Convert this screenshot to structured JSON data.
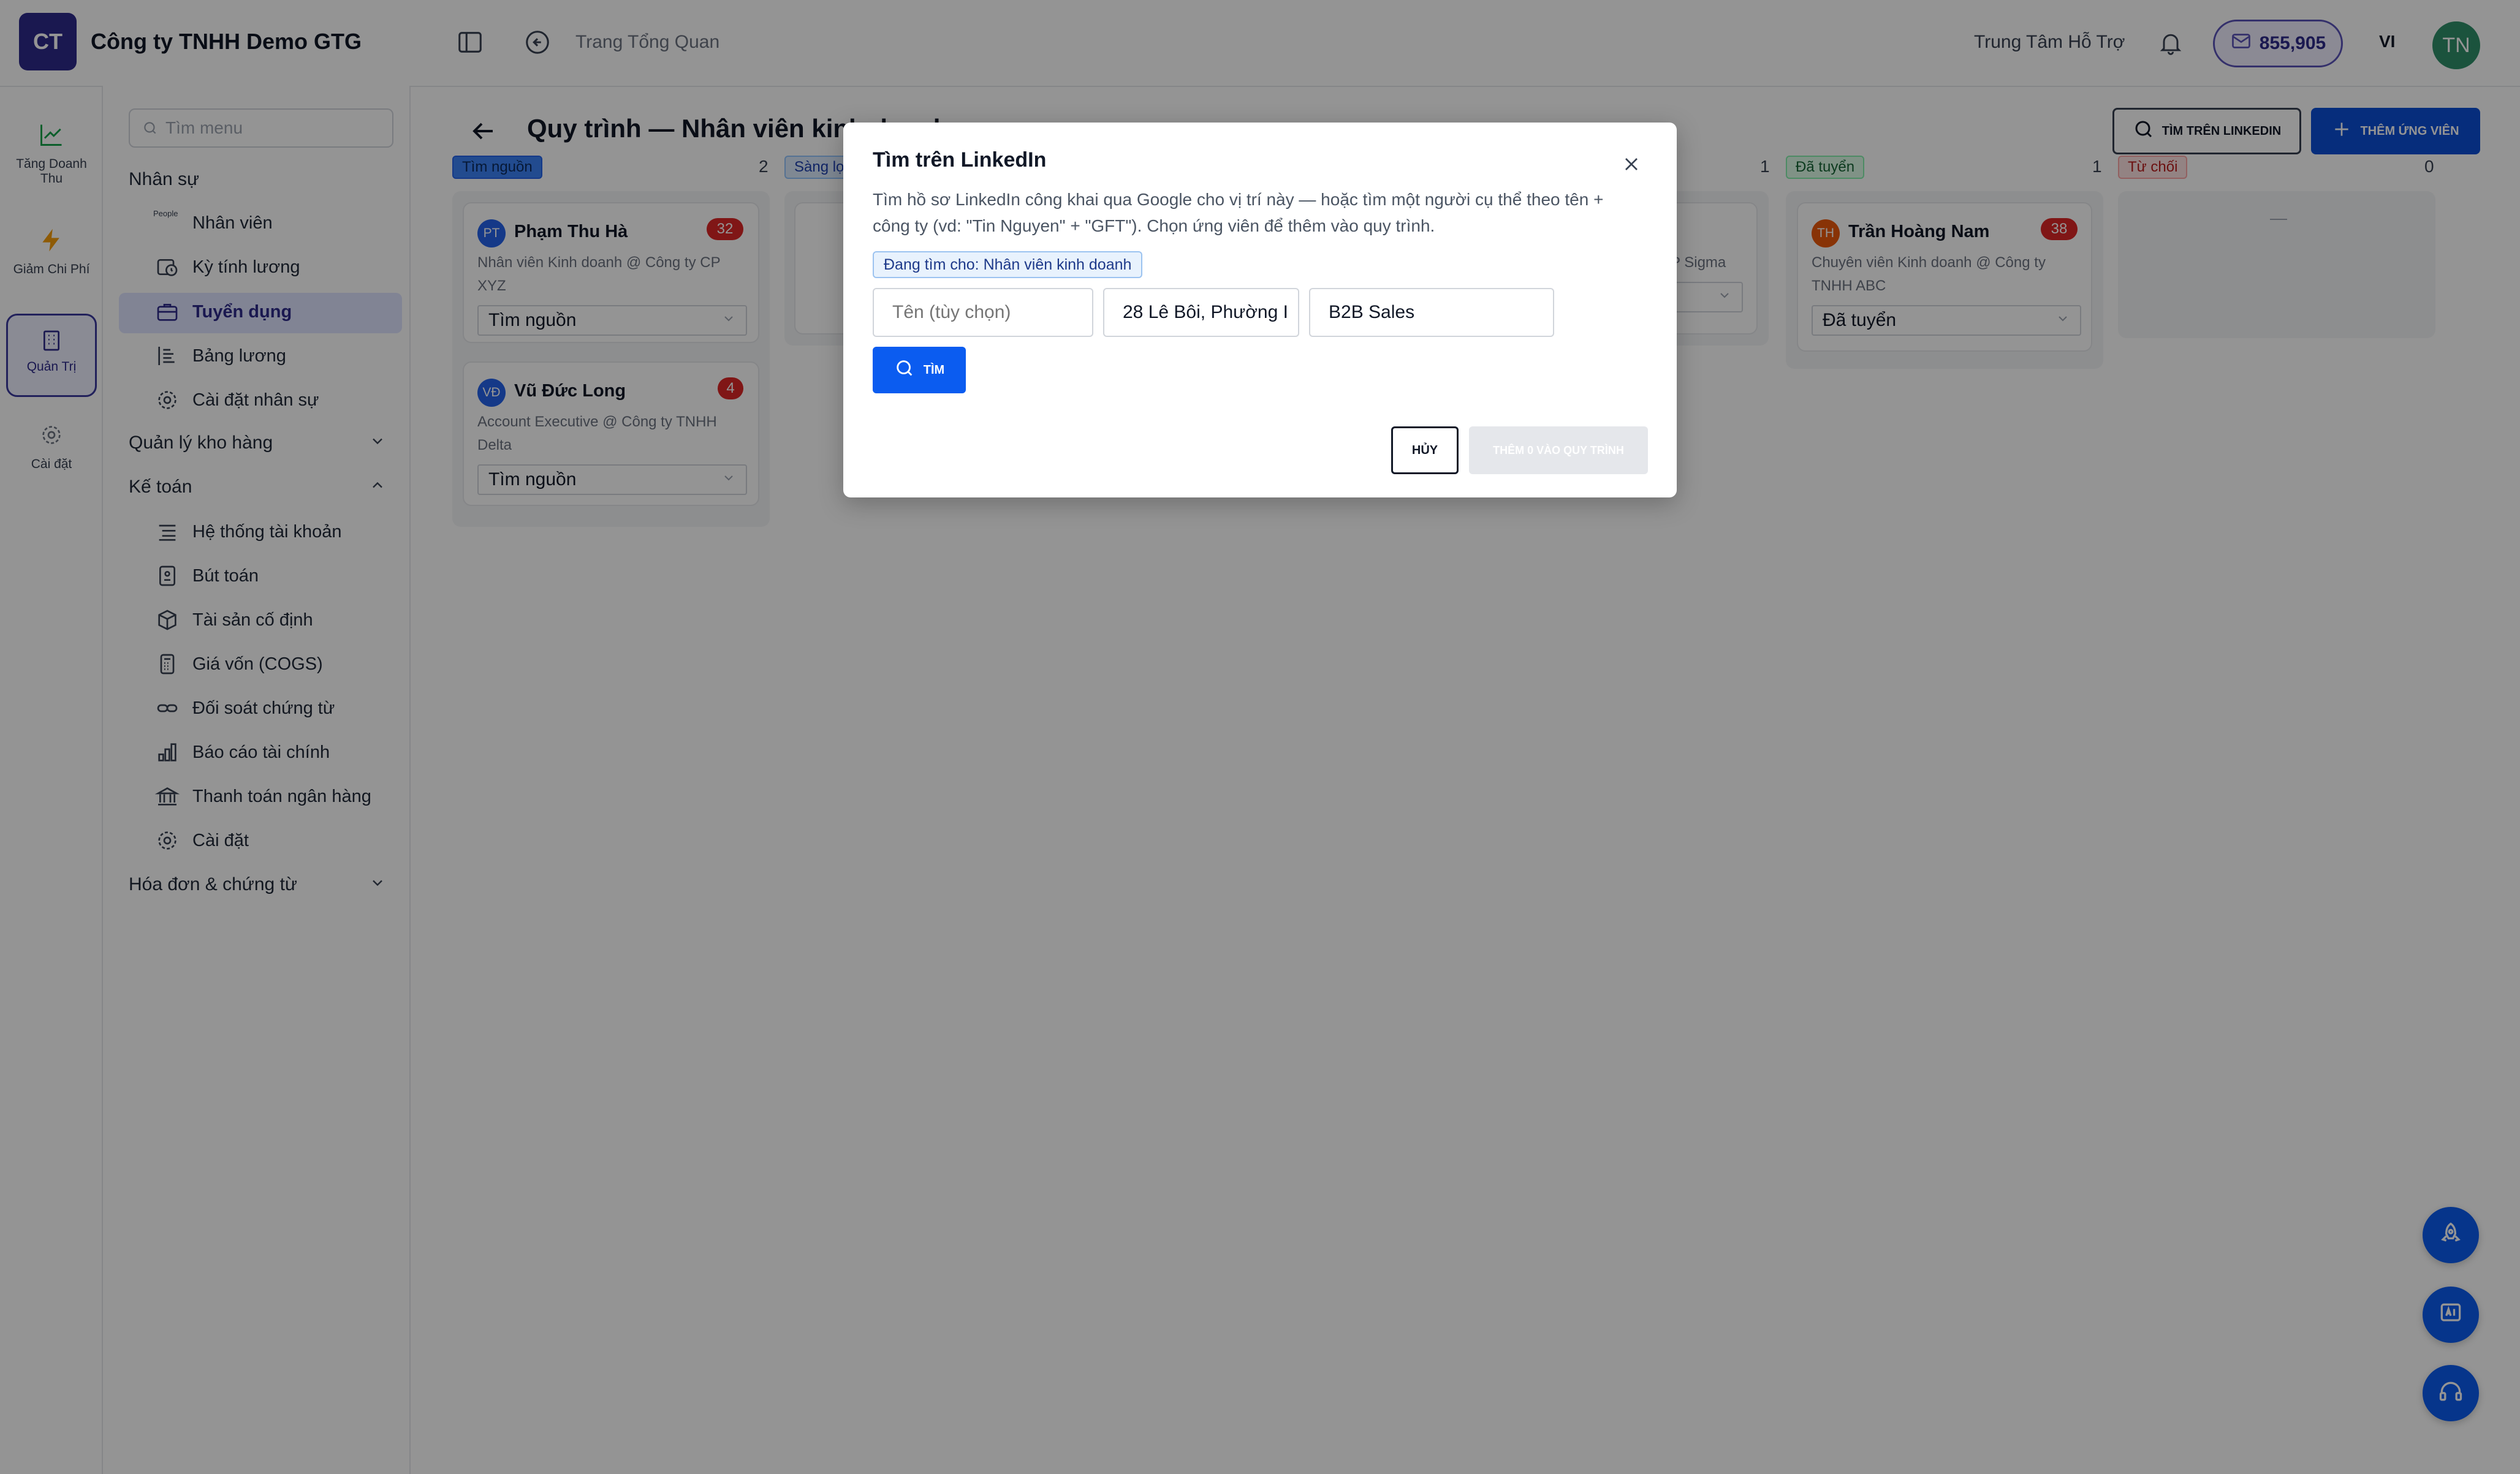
{
  "app": {
    "logo_initials": "CT",
    "company": "Công ty TNHH Demo GTG",
    "breadcrumb": "Trang Tổng Quan",
    "support": "Trung Tâm Hỗ Trợ",
    "credits": "855,905",
    "language": "VI",
    "user_initials": "TN"
  },
  "rail": [
    {
      "label": "Tăng Doanh Thu",
      "icon": "trending-up-icon"
    },
    {
      "label": "Giảm Chi Phí",
      "icon": "bolt-icon"
    },
    {
      "label": "Quản Trị",
      "icon": "building-icon",
      "active": true
    },
    {
      "label": "Cài đặt",
      "icon": "gear-icon"
    }
  ],
  "sidebar": {
    "search_placeholder": "Tìm menu",
    "sections": {
      "hr": "Nhân sự",
      "warehouse": "Quản lý kho hàng",
      "accounting": "Kế toán",
      "invoices": "Hóa đơn & chứng từ"
    },
    "hr_items": [
      "Nhân viên",
      "Kỳ tính lương",
      "Tuyển dụng",
      "Bảng lương",
      "Cài đặt nhân sự"
    ],
    "people_icon_text": "People",
    "accounting_items": [
      "Hệ thống tài khoản",
      "Bút toán",
      "Tài sản cố định",
      "Giá vốn (COGS)",
      "Đối soát chứng từ",
      "Báo cáo tài chính",
      "Thanh toán ngân hàng",
      "Cài đặt"
    ]
  },
  "main": {
    "title": "Quy trình — Nhân viên kinh doanh",
    "btn_linkedin": "TÌM TRÊN LINKEDIN",
    "btn_add": "THÊM ỨNG VIÊN",
    "columns": [
      {
        "tag": "Tìm nguồn",
        "count": "2"
      },
      {
        "tag": "Sàng lọc",
        "count": "1"
      },
      {
        "tag": "Đã tuyển",
        "count": "1"
      },
      {
        "tag": "Từ chối",
        "count": "0"
      }
    ],
    "empty_dash": "—",
    "partial_company": "P Sigma",
    "cards": [
      {
        "initials": "PT",
        "name": "Phạm Thu Hà",
        "score": "32",
        "sub1": "Nhân viên Kinh doanh @ Công ty CP",
        "sub2": "XYZ",
        "stage": "Tìm nguồn"
      },
      {
        "initials": "VĐ",
        "name": "Vũ Đức Long",
        "score": "4",
        "sub1": "Account Executive @ Công ty TNHH",
        "sub2": "Delta",
        "stage": "Tìm nguồn"
      },
      {
        "initials": "TH",
        "name": "Trần Hoàng Nam",
        "score": "38",
        "sub1": "Chuyên viên Kinh doanh @ Công ty",
        "sub2": "TNHH ABC",
        "stage": "Đã tuyển"
      }
    ]
  },
  "modal": {
    "title": "Tìm trên LinkedIn",
    "desc1": "Tìm hồ sơ LinkedIn công khai qua Google cho vị trí này — hoặc tìm một người cụ thể theo tên +",
    "desc2": "công ty (vd: \"Tin Nguyen\" + \"GFT\"). Chọn ứng viên để thêm vào quy trình.",
    "chip": "Đang tìm cho: Nhân viên kinh doanh",
    "name_placeholder": "Tên (tùy chọn)",
    "location_value": "28 Lê Bôi, Phường I",
    "keyword_value": "B2B Sales",
    "search_btn": "TÌM",
    "cancel_btn": "HỦY",
    "add_btn": "THÊM 0 VÀO QUY TRÌNH"
  },
  "colors": {
    "brand": "#2e2a8a",
    "primary": "#0b4fd6",
    "danger": "#dc2626"
  }
}
